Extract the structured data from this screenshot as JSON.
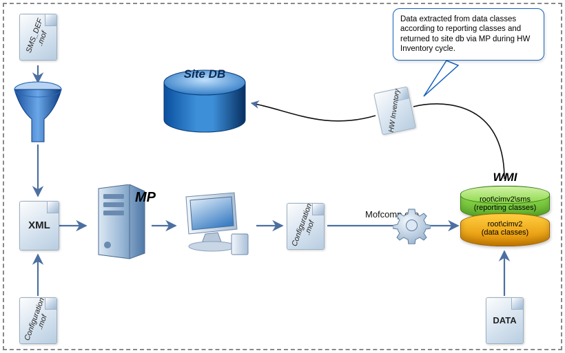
{
  "files": {
    "sms_def": "SMS_DEF\n.mof",
    "xml": "XML",
    "config_left": "Configuration\n.mof",
    "config_mid": "Configuration\n.mof",
    "hw_inv": "HW\nInventory",
    "data": "DATA"
  },
  "nodes": {
    "site_db": "Site DB",
    "mp": "MP",
    "mofcomp": "Mofcomp.exe"
  },
  "wmi": {
    "title": "WMI",
    "top_line1": "root\\cimv2\\sms",
    "top_line2": "(reporting classes)",
    "bot_line1": "root\\cimv2",
    "bot_line2": "(data classes)"
  },
  "callout": "Data extracted from data classes according to reporting classes and returned to site db via MP during HW Inventory cycle.",
  "colors": {
    "site_db_top": "#4aa3e8",
    "site_db_bot": "#0a4f9e",
    "wmi_green": "#6ec22f",
    "wmi_orange": "#f0a018",
    "arrow": "#4b6fa0"
  }
}
